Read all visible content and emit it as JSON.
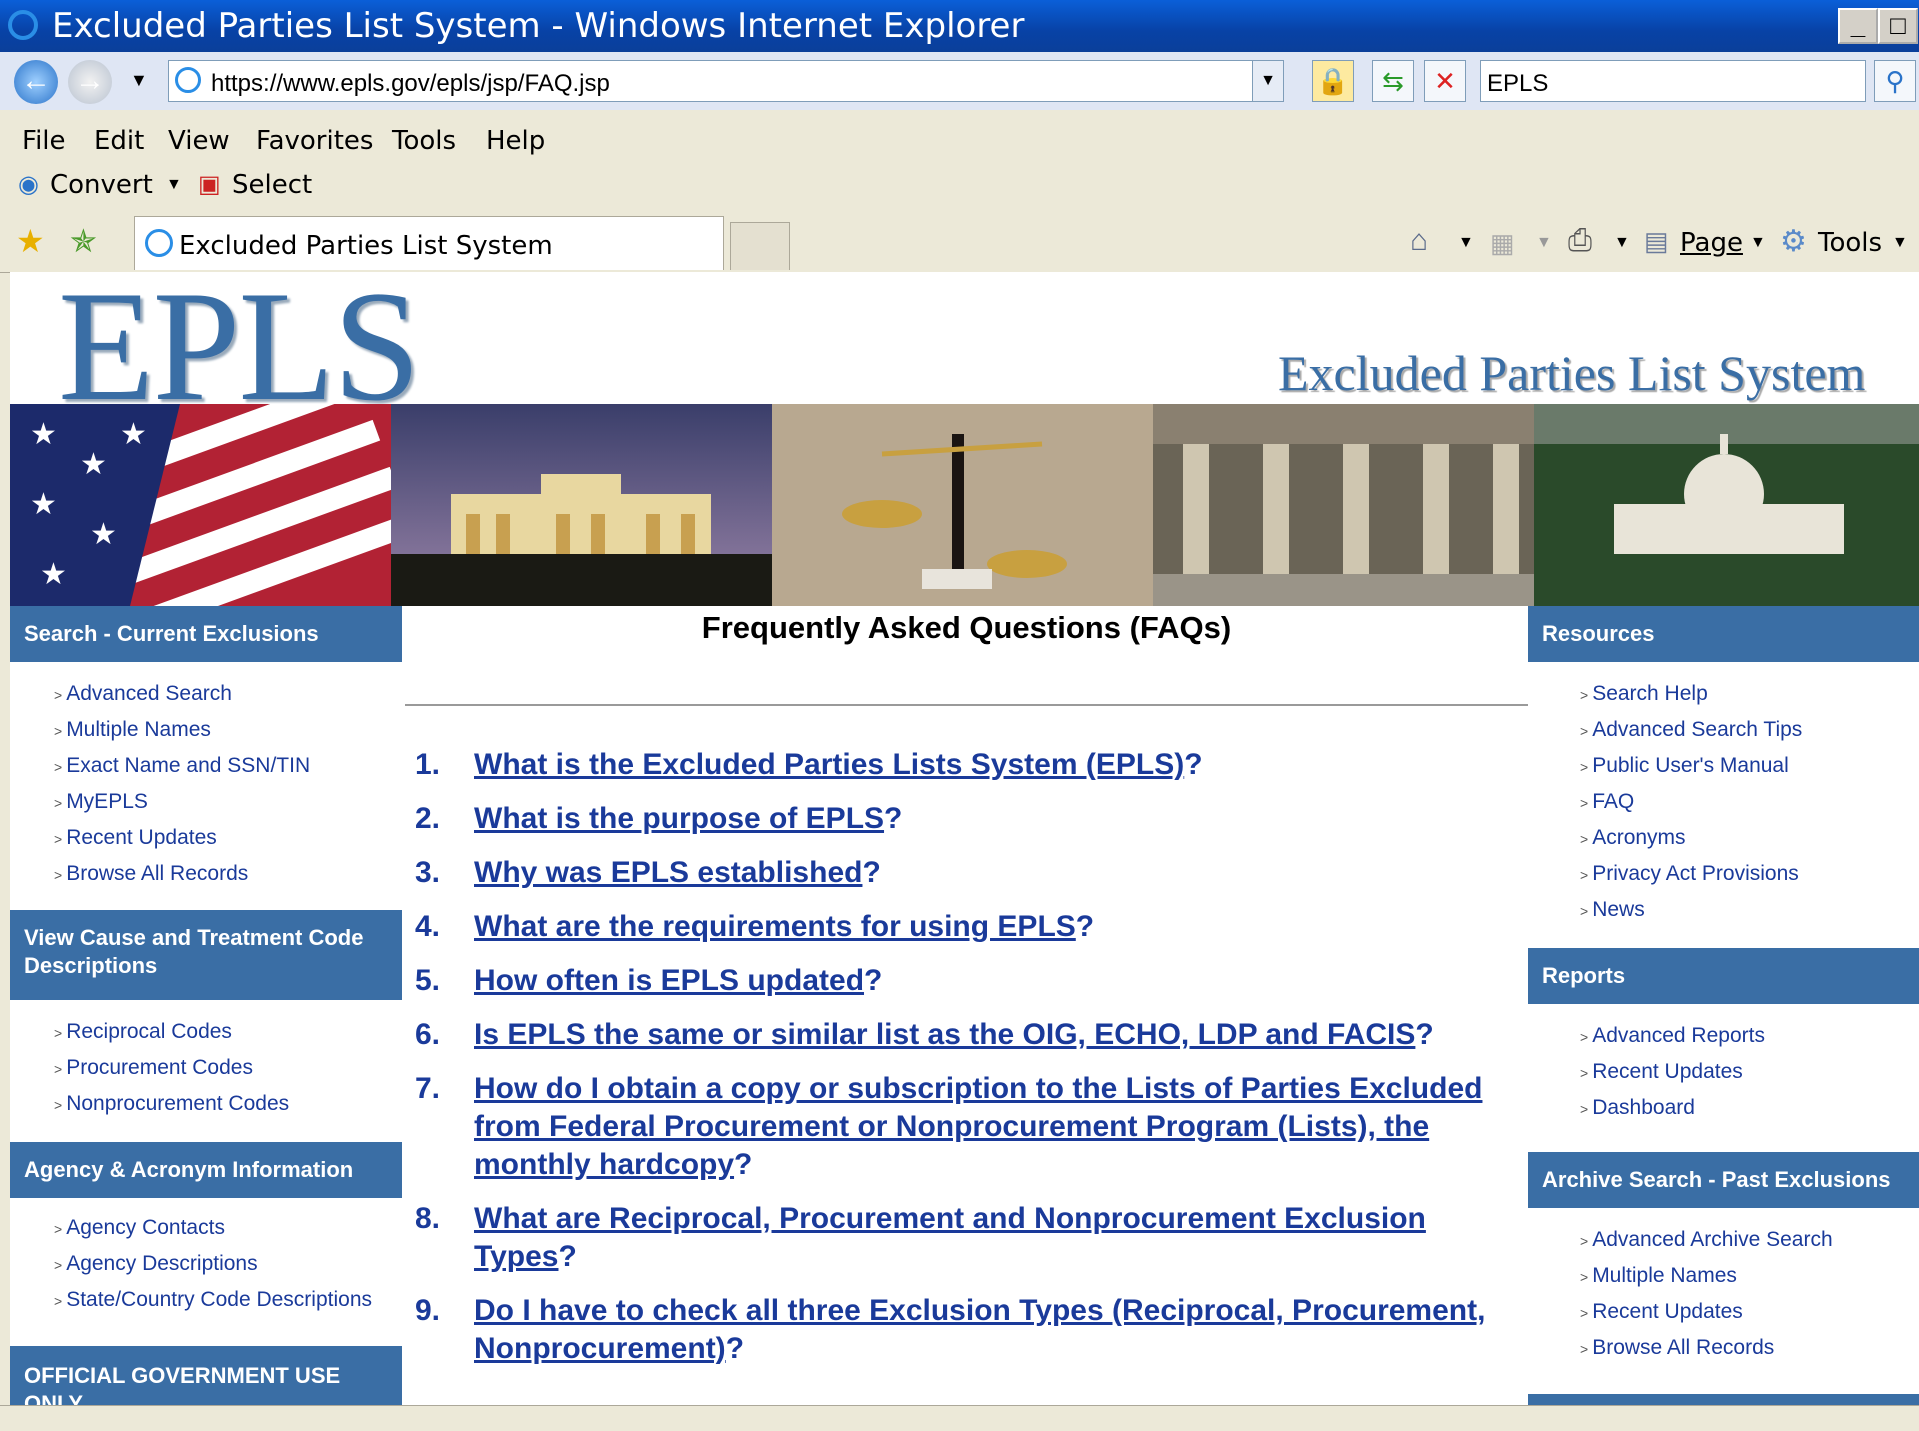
{
  "window": {
    "title": "Excluded Parties List System - Windows Internet Explorer",
    "minimize": "_",
    "maximize": "□"
  },
  "address": {
    "url": "https://www.epls.gov/epls/jsp/FAQ.jsp",
    "search_value": "EPLS"
  },
  "menu": [
    "File",
    "Edit",
    "View",
    "Favorites",
    "Tools",
    "Help"
  ],
  "toolbar2": {
    "convert": "Convert",
    "select": "Select"
  },
  "tab": {
    "title": "Excluded Parties List System"
  },
  "command_bar": {
    "page": "Page",
    "tools": "Tools"
  },
  "header": {
    "logo": "EPLS",
    "subtitle": "Excluded Parties List System"
  },
  "left_sidebar": {
    "search_header": "Search - Current Exclusions",
    "search_links": [
      "Advanced Search",
      "Multiple Names",
      "Exact Name and SSN/TIN",
      "MyEPLS",
      "Recent Updates",
      "Browse All Records"
    ],
    "cause_header": "View Cause and Treatment Code Descriptions",
    "cause_links": [
      "Reciprocal Codes",
      "Procurement Codes",
      "Nonprocurement Codes"
    ],
    "agency_header": "Agency & Acronym Information",
    "agency_links": [
      "Agency Contacts",
      "Agency Descriptions",
      "State/Country Code Descriptions"
    ],
    "official_header": "OFFICIAL GOVERNMENT USE ONLY"
  },
  "right_sidebar": {
    "resources_header": "Resources",
    "resources_links": [
      "Search Help",
      "Advanced Search Tips",
      "Public User's Manual",
      "FAQ",
      "Acronyms",
      "Privacy Act Provisions",
      "News"
    ],
    "reports_header": "Reports",
    "reports_links": [
      "Advanced Reports",
      "Recent Updates",
      "Dashboard"
    ],
    "archive_header": "Archive Search - Past Exclusions",
    "archive_links": [
      "Advanced Archive Search",
      "Multiple Names",
      "Recent Updates",
      "Browse All Records"
    ]
  },
  "main": {
    "title": "Frequently Asked Questions (FAQs)",
    "faqs": [
      {
        "num": "1.",
        "link": "What is the Excluded Parties Lists System (EPLS)",
        "suffix": "?"
      },
      {
        "num": "2.",
        "link": "What is the purpose of EPLS",
        "suffix": "?"
      },
      {
        "num": "3.",
        "link": "Why was EPLS established",
        "suffix": "?"
      },
      {
        "num": "4.",
        "link": "What are the requirements for using EPLS",
        "suffix": "?"
      },
      {
        "num": "5.",
        "link": "How often is EPLS updated",
        "suffix": "?"
      },
      {
        "num": "6.",
        "link": "Is EPLS the same or similar list as the OIG, ECHO, LDP and FACIS",
        "suffix": "?"
      },
      {
        "num": "7.",
        "link": "How do I obtain a copy or subscription to the Lists of Parties Excluded from Federal Procurement or Nonprocurement Program (Lists), the monthly hardcopy",
        "suffix": "?"
      },
      {
        "num": "8.",
        "link": "What are Reciprocal, Procurement and Nonprocurement Exclusion Types",
        "suffix": "?"
      },
      {
        "num": "9.",
        "link": "Do I have to check all three Exclusion Types (Reciprocal, Procurement, Nonprocurement)",
        "suffix": "?"
      }
    ]
  }
}
